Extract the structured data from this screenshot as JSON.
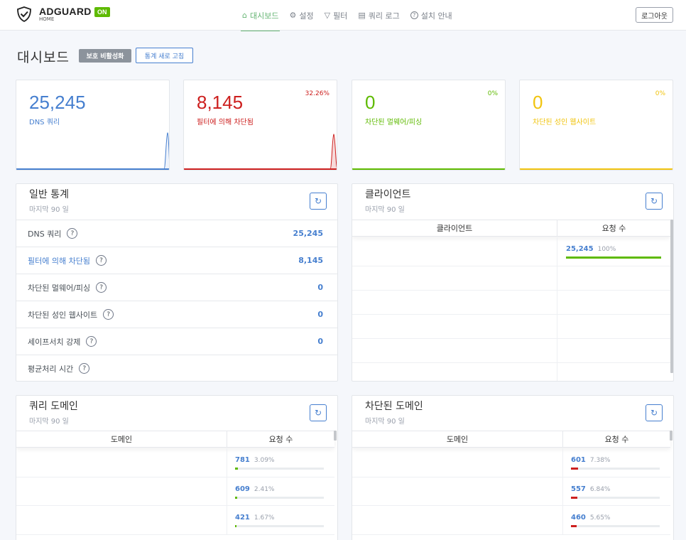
{
  "app": {
    "name": "ADGUARD",
    "sub": "HOME",
    "status_badge": "ON"
  },
  "nav": [
    {
      "label": "대시보드",
      "icon": "home-icon",
      "glyph": "⌂",
      "active": true
    },
    {
      "label": "설정",
      "icon": "gear-icon",
      "glyph": "⚙",
      "active": false
    },
    {
      "label": "필터",
      "icon": "filter-icon",
      "glyph": "▽",
      "active": false
    },
    {
      "label": "쿼리 로그",
      "icon": "document-icon",
      "glyph": "▤",
      "active": false
    },
    {
      "label": "설치 안내",
      "icon": "help-icon",
      "glyph": "?",
      "active": false
    }
  ],
  "header": {
    "logout_label": "로그아웃"
  },
  "page": {
    "title": "대시보드",
    "disable_protection_label": "보호 비활성화",
    "refresh_stats_label": "통계 새로 고침"
  },
  "stat_cards": [
    {
      "value": "25,245",
      "label": "DNS 쿼리",
      "percent": "",
      "color": "#467fcf"
    },
    {
      "value": "8,145",
      "label": "필터에 의해 차단됨",
      "percent": "32.26%",
      "color": "#cd201f"
    },
    {
      "value": "0",
      "label": "차단된 멀웨어/피싱",
      "percent": "0%",
      "color": "#5eba00"
    },
    {
      "value": "0",
      "label": "차단된 성인 웹사이트",
      "percent": "0%",
      "color": "#f1c40f"
    }
  ],
  "general": {
    "title": "일반 통계",
    "subtitle": "마지막 90 일",
    "rows": [
      {
        "label": "DNS 쿼리",
        "value": "25,245"
      },
      {
        "label": "필터에 의해 차단됨",
        "value": "8,145"
      },
      {
        "label": "차단된 멀웨어/피싱",
        "value": "0"
      },
      {
        "label": "차단된 성인 웹사이트",
        "value": "0"
      },
      {
        "label": "세이프서치 강제",
        "value": "0"
      },
      {
        "label": "평균처리 시간",
        "value": ""
      }
    ]
  },
  "clients": {
    "title": "클라이언트",
    "subtitle": "마지막 90 일",
    "col_client": "클라이언트",
    "col_requests": "요청 수",
    "rows": [
      {
        "count": "25,245",
        "percent": "100%",
        "fill": 1.0
      }
    ]
  },
  "query_domains": {
    "title": "쿼리 도메인",
    "subtitle": "마지막 90 일",
    "col_domain": "도메인",
    "col_requests": "요청 수",
    "rows": [
      {
        "count": "781",
        "percent": "3.09%",
        "fill": 0.0309
      },
      {
        "count": "609",
        "percent": "2.41%",
        "fill": 0.0241
      },
      {
        "count": "421",
        "percent": "1.67%",
        "fill": 0.0167
      }
    ]
  },
  "blocked_domains": {
    "title": "차단된 도메인",
    "subtitle": "마지막 90 일",
    "col_domain": "도메인",
    "col_requests": "요청 수",
    "rows": [
      {
        "count": "601",
        "percent": "7.38%",
        "fill": 0.0738
      },
      {
        "count": "557",
        "percent": "6.84%",
        "fill": 0.0684
      },
      {
        "count": "460",
        "percent": "5.65%",
        "fill": 0.0565
      }
    ]
  }
}
